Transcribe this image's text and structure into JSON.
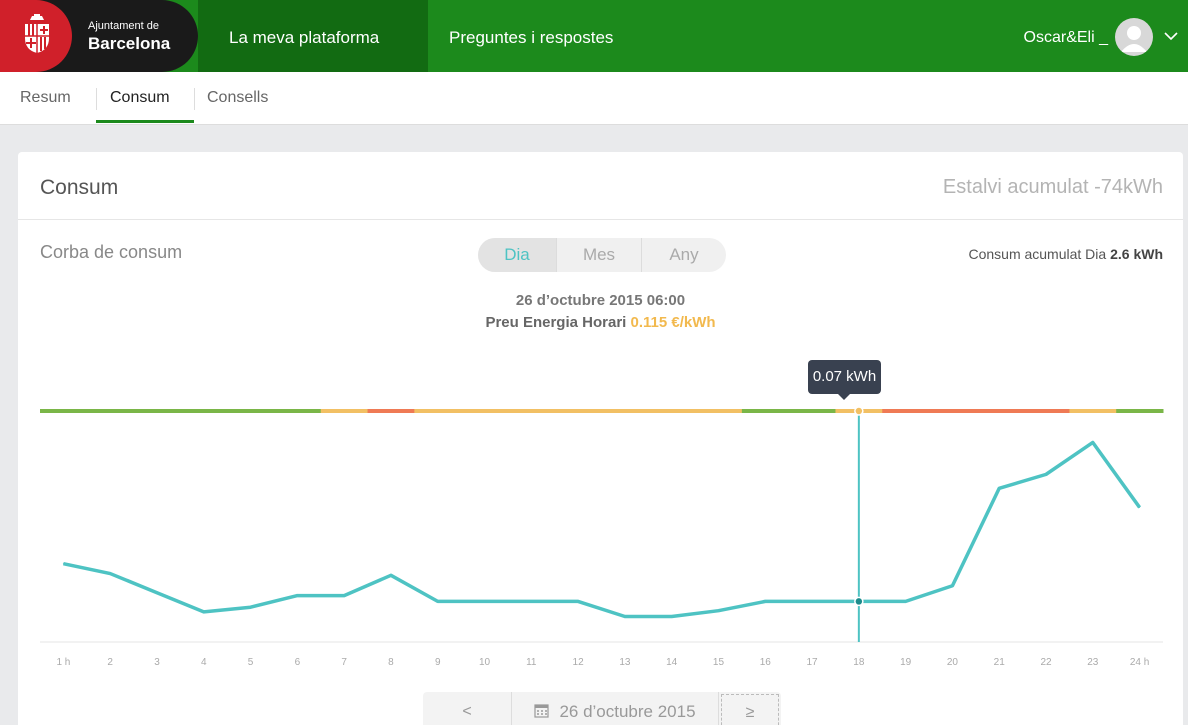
{
  "header": {
    "logo_line1": "Ajuntament de",
    "logo_line2": "Barcelona",
    "nav": [
      "La meva plataforma",
      "Preguntes i respostes"
    ],
    "user": "Oscar&Eli _"
  },
  "tabs": [
    "Resum",
    "Consum",
    "Consells"
  ],
  "card": {
    "title": "Consum",
    "savings": "Estalvi acumulat -74kWh",
    "curve_label": "Corba de consum",
    "periods": [
      "Dia",
      "Mes",
      "Any"
    ],
    "selected_period": "Dia",
    "acc_label": "Consum acumulat Dia",
    "acc_value": "2.6 kWh",
    "info_date": "26 d’octubre 2015 06:00",
    "price_label": "Preu Energia Horari",
    "price_value": "0.115 €/kWh",
    "tooltip": "0.07 kWh",
    "date_prev": "<",
    "date_label": "26 d’octubre 2015",
    "date_next": "≥"
  },
  "colors": {
    "brand_green": "#1c8a1c",
    "line": "#4ec3c3",
    "tariff_low": "#7ab648",
    "tariff_mid": "#f2c064",
    "tariff_high": "#ef7a55"
  },
  "chart_data": {
    "type": "line",
    "x": [
      "1 h",
      "2",
      "3",
      "4",
      "5",
      "6",
      "7",
      "8",
      "9",
      "10",
      "11",
      "12",
      "13",
      "14",
      "15",
      "16",
      "17",
      "18",
      "19",
      "20",
      "21",
      "22",
      "23",
      "24 h"
    ],
    "values": [
      0.135,
      0.118,
      0.085,
      0.052,
      0.06,
      0.08,
      0.08,
      0.115,
      0.07,
      0.07,
      0.07,
      0.07,
      0.044,
      0.044,
      0.054,
      0.07,
      0.07,
      0.07,
      0.07,
      0.097,
      0.265,
      0.289,
      0.344,
      0.232
    ],
    "ylim": [
      0,
      0.4
    ],
    "highlight_index": 17,
    "tariff_bands": [
      "low",
      "low",
      "low",
      "low",
      "low",
      "low",
      "mid",
      "high",
      "mid",
      "mid",
      "mid",
      "mid",
      "mid",
      "mid",
      "mid",
      "low",
      "low",
      "mid",
      "high",
      "high",
      "high",
      "high",
      "mid",
      "low"
    ]
  }
}
